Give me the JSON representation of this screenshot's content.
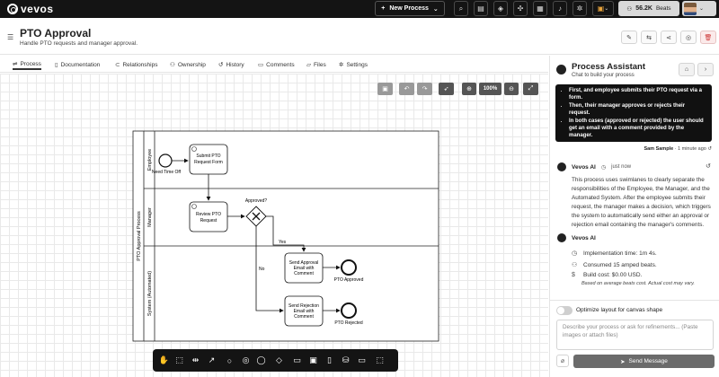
{
  "topbar": {
    "logo_text": "vevos",
    "new_process_label": "New Process",
    "beats_value": "56.2K",
    "beats_label": "Beats"
  },
  "header": {
    "title": "PTO Approval",
    "subtitle": "Handle PTO requests and manager approval."
  },
  "tabs": [
    {
      "label": "Process",
      "icon": "flow-icon",
      "active": true
    },
    {
      "label": "Documentation",
      "icon": "book-icon"
    },
    {
      "label": "Relationships",
      "icon": "link-icon"
    },
    {
      "label": "Ownership",
      "icon": "users-icon"
    },
    {
      "label": "History",
      "icon": "history-icon"
    },
    {
      "label": "Comments",
      "icon": "comment-icon"
    },
    {
      "label": "Files",
      "icon": "folder-icon"
    },
    {
      "label": "Settings",
      "icon": "gear-icon"
    }
  ],
  "canvas": {
    "zoom": "100%"
  },
  "diagram": {
    "pool_label": "PTO Approval Process",
    "lanes": [
      "Employee",
      "Manager",
      "System (Automated)"
    ],
    "start_event": "Need Time Off",
    "tasks": {
      "submit": [
        "Submit PTO",
        "Request Form"
      ],
      "review": [
        "Review PTO",
        "Request"
      ],
      "approve_email": [
        "Send Approval",
        "Email with",
        "Comment"
      ],
      "reject_email": [
        "Send Rejection",
        "Email with",
        "Comment"
      ]
    },
    "gateway_label": "Approved?",
    "yes_label": "Yes",
    "no_label": "No",
    "end_approved": "PTO Approved",
    "end_rejected": "PTO Rejected"
  },
  "panel": {
    "title": "Process Assistant",
    "subtitle": "Chat to build your process",
    "user_bullets": [
      "First, and employee submits their PTO request via a form.",
      "Then, their manager approves or rejects their request.",
      "In both cases (approved or rejected) the user should get an email with a comment provided by the manager."
    ],
    "user_name": "Sam Sample",
    "user_time": "1 minute ago",
    "ai_name": "Vevos AI",
    "ai_time": "just now",
    "ai_message": "This process uses swimlanes to clearly separate the responsibilities of the Employee, the Manager, and the Automated System. After the employee submits their request, the manager makes a decision, which triggers the system to automatically send either an approval or rejection email containing the manager's comments.",
    "ai_name_2": "Vevos AI",
    "implementation_time": "Implementation time: 1m 4s.",
    "consumed": "Consumed 15 amped beats.",
    "build_cost": "Build cost: $0.00 USD.",
    "footnote": "Based on average beats cost. Actual cost may vary.",
    "toggle_label": "Optimize layout for canvas shape",
    "input_placeholder": "Describe your process or ask for refinements... (Paste images or attach files)",
    "send_label": "Send Message"
  }
}
